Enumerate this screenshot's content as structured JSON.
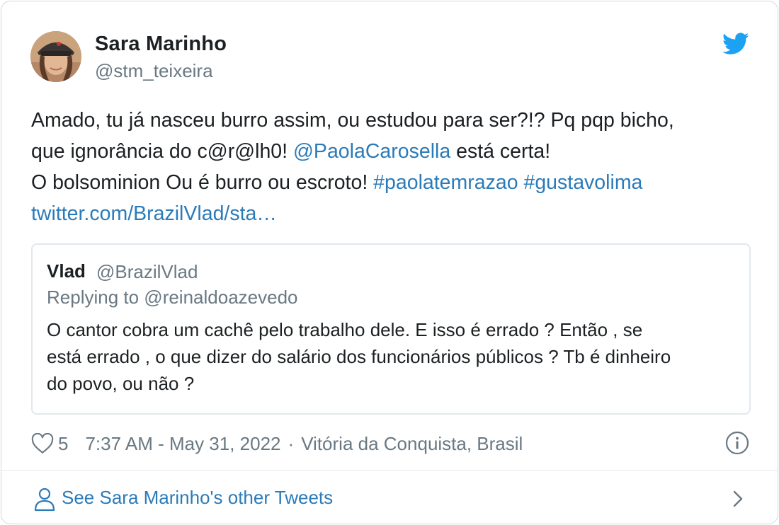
{
  "author": {
    "name": "Sara Marinho",
    "handle": "@stm_teixeira"
  },
  "tweet": {
    "line1": "Amado, tu já nasceu burro assim, ou estudou para ser?!? Pq pqp bicho,",
    "line2_pre": "que ignorância do c@r@lh0! ",
    "line2_mention": "@PaolaCarosella",
    "line2_post": " está certa!",
    "line3_pre": "O bolsominion Ou é burro ou escroto! ",
    "hashtag1": "#paolatemrazao",
    "hashtag2": "#gustavolima",
    "link": "twitter.com/BrazilVlad/sta…"
  },
  "quote": {
    "name": "Vlad",
    "handle": "@BrazilVlad",
    "replying_to": "Replying to @reinaldoazevedo",
    "line1": "O cantor cobra um cachê pelo trabalho dele. E isso é errado ? Então , se",
    "line2": "está errado , o que dizer do salário dos funcionários públicos ? Tb é dinheiro",
    "line3": "do povo, ou não ?"
  },
  "meta": {
    "likes": "5",
    "timestamp": "7:37 AM - May 31, 2022",
    "separator": "·",
    "location": "Vitória da Conquista, Brasil"
  },
  "footer": {
    "see_more": "See Sara Marinho's other Tweets"
  },
  "icons": {
    "twitter": "twitter-bird-icon",
    "heart": "heart-icon",
    "info": "info-icon",
    "user": "user-icon",
    "chevron": "chevron-right-icon"
  },
  "colors": {
    "link": "#2b7bb9",
    "secondary_text": "#697882",
    "twitter_blue": "#1da1f2",
    "border": "#cfd9de"
  }
}
